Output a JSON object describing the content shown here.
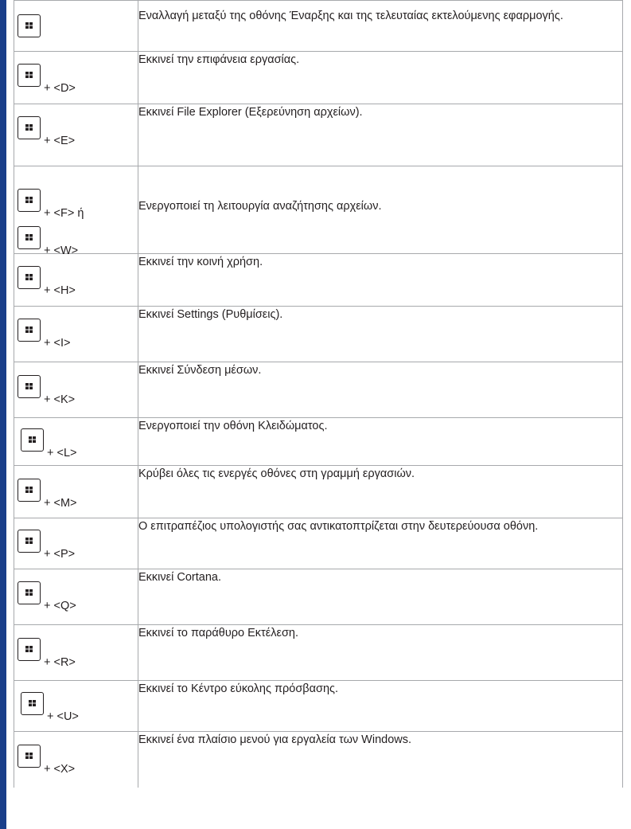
{
  "rows": [
    {
      "combo": "",
      "description": "Εναλλαγή μεταξύ της οθόνης Έναρξης και της τελευταίας εκτελούμενης εφαρμογής."
    },
    {
      "combo": "+ <D>",
      "description": "Εκκινεί την επιφάνεια εργασίας."
    },
    {
      "combo": "+ <E>",
      "description": "Εκκινεί File Explorer (Εξερεύνηση αρχείων)."
    },
    {
      "combo": "+ <F> ή",
      "combo2": "+ <W>",
      "description": "Ενεργοποιεί τη λειτουργία αναζήτησης αρχείων."
    },
    {
      "combo": "+ <H>",
      "description": "Εκκινεί την κοινή χρήση."
    },
    {
      "combo": "+ <I>",
      "description": "Εκκινεί Settings (Ρυθμίσεις)."
    },
    {
      "combo": "+ <K>",
      "description": "Εκκινεί Σύνδεση μέσων."
    },
    {
      "combo": "+ <L>",
      "description": "Ενεργοποιεί την οθόνη Κλειδώματος."
    },
    {
      "combo": "+ <M>",
      "description": "Κρύβει όλες τις ενεργές οθόνες στη γραμμή εργασιών."
    },
    {
      "combo": "+ <P>",
      "description": "Ο επιτραπέζιος υπολογιστής σας αντικατοπτρίζεται στην δευτερεύουσα οθόνη."
    },
    {
      "combo": "+ <Q>",
      "description": "Εκκινεί Cortana."
    },
    {
      "combo": "+ <R>",
      "description": "Εκκινεί το παράθυρο Εκτέλεση."
    },
    {
      "combo": "+ <U>",
      "description": "Εκκινεί το Κέντρο εύκολης πρόσβασης."
    },
    {
      "combo": "+ <X>",
      "description": "Εκκινεί ένα πλαίσιο μενού για εργαλεία των Windows."
    }
  ],
  "colors": {
    "accent_bar": "#1a3f8a",
    "border": "#a7a9ac",
    "text": "#231f20"
  },
  "icons": {
    "key": "windows-key-icon"
  }
}
